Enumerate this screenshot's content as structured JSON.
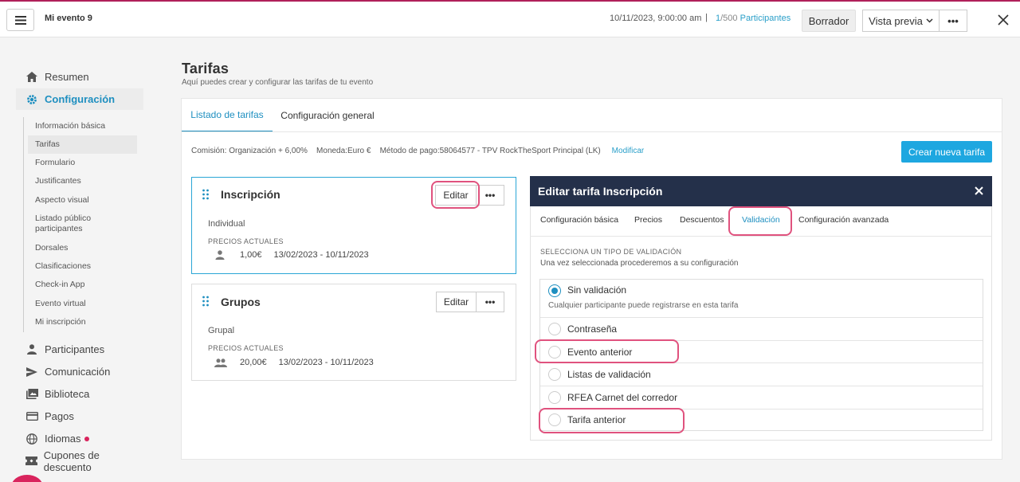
{
  "topbar": {
    "event_name": "Mi evento 9",
    "date": "10/11/2023, 9:00:00 am",
    "separator": "|",
    "participants_current": "1",
    "participants_total": "/500",
    "participants_label": "Participantes",
    "borrador_label": "Borrador",
    "vista_previa_label": "Vista previa",
    "more_label": "•••"
  },
  "sidebar": {
    "main_items": [
      {
        "label": "Resumen",
        "icon": "home-icon"
      },
      {
        "label": "Configuración",
        "icon": "gear-icon"
      },
      {
        "label": "Participantes",
        "icon": "person-icon"
      },
      {
        "label": "Comunicación",
        "icon": "send-icon"
      },
      {
        "label": "Biblioteca",
        "icon": "library-icon"
      },
      {
        "label": "Pagos",
        "icon": "card-icon"
      },
      {
        "label": "Idiomas",
        "icon": "globe-icon"
      },
      {
        "label": "Cupones de descuento",
        "icon": "ticket-icon"
      }
    ],
    "sub_items": [
      "Información básica",
      "Tarifas",
      "Formulario",
      "Justificantes",
      "Aspecto visual",
      "Listado público participantes",
      "Dorsales",
      "Clasificaciones",
      "Check-in App",
      "Evento virtual",
      "Mi inscripción"
    ]
  },
  "page": {
    "title": "Tarifas",
    "subtitle": "Aquí puedes crear y configurar las tarifas de tu evento",
    "tabs": [
      "Listado de tarifas",
      "Configuración general"
    ],
    "info": {
      "comision_label": "Comisión:",
      "comision_value": "Organización + 6,00%",
      "moneda_label": "Moneda:",
      "moneda_value": "Euro €",
      "metodo_label": "Método de pago:",
      "metodo_value": "58064577 - TPV RockTheSport Principal (LK)",
      "modificar": "Modificar"
    },
    "crear_label": "Crear nueva tarifa"
  },
  "cards": [
    {
      "title": "Inscripción",
      "edit_label": "Editar",
      "more_label": "•••",
      "type": "Individual",
      "prices_label": "PRECIOS ACTUALES",
      "price": "1,00€",
      "dates": "13/02/2023 - 10/11/2023"
    },
    {
      "title": "Grupos",
      "edit_label": "Editar",
      "more_label": "•••",
      "type": "Grupal",
      "prices_label": "PRECIOS ACTUALES",
      "price": "20,00€",
      "dates": "13/02/2023 - 10/11/2023"
    }
  ],
  "edit_panel": {
    "title": "Editar tarifa Inscripción",
    "tabs": [
      "Configuración básica",
      "Precios",
      "Descuentos",
      "Validación",
      "Configuración avanzada"
    ],
    "heading": "SELECCIONA UN TIPO DE VALIDACIÓN",
    "desc": "Una vez seleccionada procederemos a su configuración",
    "options": [
      {
        "label": "Sin validación",
        "selected": true
      },
      {
        "label": "Contraseña",
        "selected": false
      },
      {
        "label": "Evento anterior",
        "selected": false
      },
      {
        "label": "Listas de validación",
        "selected": false
      },
      {
        "label": "RFEA Carnet del corredor",
        "selected": false
      },
      {
        "label": "Tarifa anterior",
        "selected": false
      }
    ],
    "first_option_desc": "Cualquier participante puede registrarse en esta tarifa"
  },
  "colors": {
    "accent": "#1e8fc0",
    "header_dark": "#24304a",
    "highlight": "#e0527e",
    "primary_button": "#1ea7e0"
  }
}
